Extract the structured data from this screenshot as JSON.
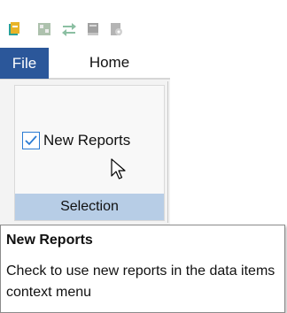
{
  "quick_access": {
    "icons": [
      "app-icon",
      "report-icon",
      "transfer-icon",
      "book-icon",
      "gear-icon"
    ]
  },
  "tabs": {
    "file_label": "File",
    "home_label": "Home"
  },
  "ribbon": {
    "group_label": "Selection",
    "checkbox_label": "New Reports",
    "checkbox_checked": true
  },
  "tooltip": {
    "title": "New Reports",
    "body": "Check to use new reports in the data items context menu"
  },
  "colors": {
    "file_tab_bg": "#2b579a",
    "group_label_bg": "#b7cde6",
    "checkbox_accent": "#2b7cd3"
  }
}
